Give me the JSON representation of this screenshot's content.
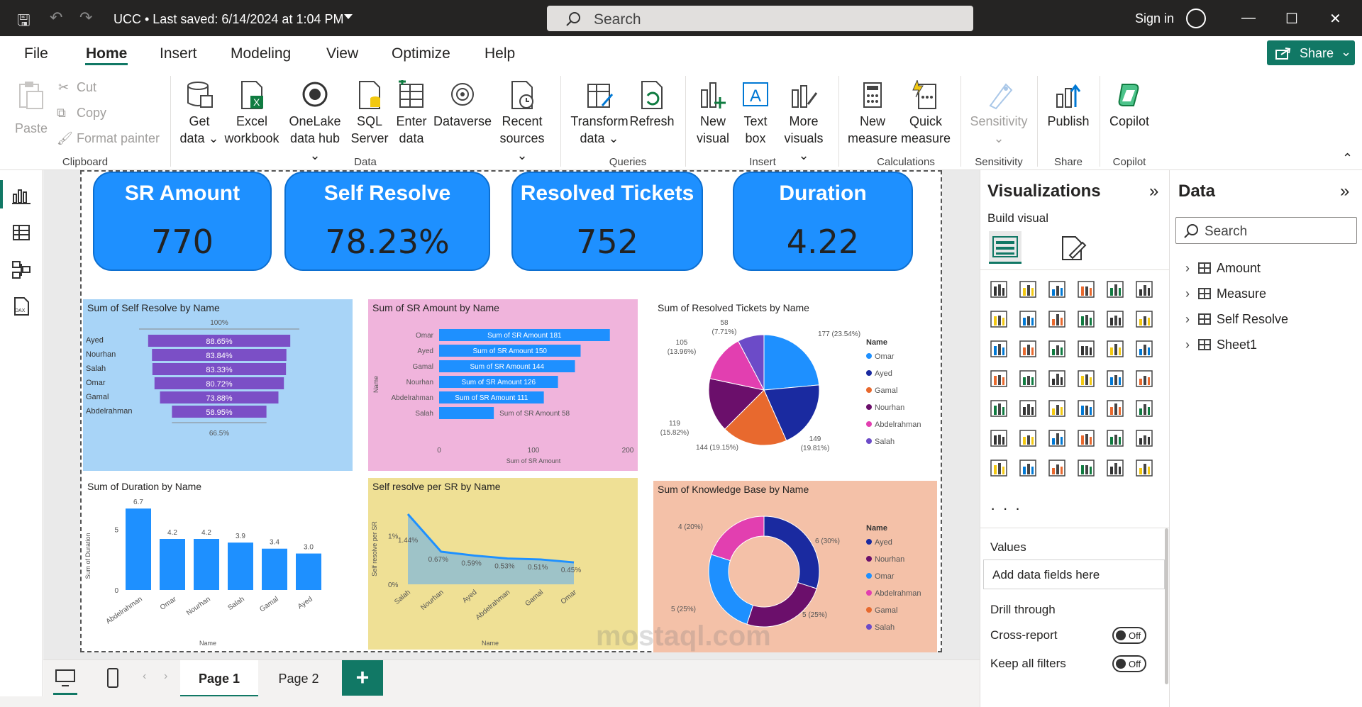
{
  "titlebar": {
    "title": "UCC • Last saved: 6/14/2024 at 1:04 PM",
    "search_placeholder": "Search",
    "sign_in": "Sign in"
  },
  "menu": {
    "tabs": [
      "File",
      "Home",
      "Insert",
      "Modeling",
      "View",
      "Optimize",
      "Help"
    ],
    "share": "Share"
  },
  "ribbon": {
    "clipboard": {
      "paste": "Paste",
      "cut": "Cut",
      "copy": "Copy",
      "format_painter": "Format painter",
      "group": "Clipboard"
    },
    "data": {
      "get_data": [
        "Get",
        "data ⌄"
      ],
      "excel": [
        "Excel",
        "workbook"
      ],
      "onelake": [
        "OneLake",
        "data hub ⌄"
      ],
      "sql": [
        "SQL",
        "Server"
      ],
      "enter": [
        "Enter",
        "data"
      ],
      "dataverse": [
        "Dataverse",
        ""
      ],
      "recent": [
        "Recent",
        "sources ⌄"
      ],
      "group": "Data"
    },
    "queries": {
      "transform": [
        "Transform",
        "data ⌄"
      ],
      "refresh": [
        "Refresh",
        ""
      ],
      "group": "Queries"
    },
    "insert": {
      "new_visual": [
        "New",
        "visual"
      ],
      "text_box": [
        "Text",
        "box"
      ],
      "more_visuals": [
        "More",
        "visuals ⌄"
      ],
      "group": "Insert"
    },
    "calculations": {
      "new_measure": [
        "New",
        "measure"
      ],
      "quick_measure": [
        "Quick",
        "measure"
      ],
      "group": "Calculations"
    },
    "sensitivity": {
      "label": [
        "Sensitivity",
        "⌄"
      ],
      "group": "Sensitivity"
    },
    "share": {
      "publish": [
        "Publish",
        ""
      ],
      "group": "Share"
    },
    "copilot": {
      "label": [
        "Copilot",
        ""
      ],
      "group": "Copilot"
    }
  },
  "kpis": [
    {
      "title": "SR Amount",
      "value": "770"
    },
    {
      "title": "Self Resolve",
      "value": "78.23%"
    },
    {
      "title": "Resolved Tickets",
      "value": "752"
    },
    {
      "title": "Duration",
      "value": "4.22"
    }
  ],
  "colors": {
    "accent": "#117865",
    "kpi": "#1e90ff",
    "funnel": "#7b4fc6",
    "bar": "#1e90ff",
    "funnel_bg": "#a8d4f7",
    "bar_bg": "#f0b4dc",
    "line_bg": "#efe095",
    "donut_bg": "#f4c1a8"
  },
  "chart_data": [
    {
      "type": "bar",
      "subtype": "funnel",
      "title": "Sum of Self Resolve by Name",
      "categories": [
        "Ayed",
        "Nourhan",
        "Salah",
        "Omar",
        "Gamal",
        "Abdelrahman"
      ],
      "values": [
        88.65,
        83.84,
        83.33,
        80.72,
        73.88,
        58.95
      ],
      "labels": [
        "88.65%",
        "83.84%",
        "83.33%",
        "80.72%",
        "73.88%",
        "58.95%"
      ],
      "top_label": "100%",
      "bottom_label": "66.5%"
    },
    {
      "type": "bar",
      "orientation": "horizontal",
      "title": "Sum of SR Amount by Name",
      "categories": [
        "Omar",
        "Ayed",
        "Gamal",
        "Nourhan",
        "Abdelrahman",
        "Salah"
      ],
      "values": [
        181,
        150,
        144,
        126,
        111,
        58
      ],
      "label_prefix": "Sum of SR Amount ",
      "xlabel": "Sum of SR Amount",
      "ylabel": "Name",
      "xlim": [
        0,
        200
      ],
      "xticks": [
        "0",
        "100",
        "200"
      ]
    },
    {
      "type": "pie",
      "title": "Sum of Resolved Tickets by Name",
      "legend_title": "Name",
      "categories": [
        "Omar",
        "Ayed",
        "Gamal",
        "Nourhan",
        "Abdelrahman",
        "Salah"
      ],
      "values": [
        177,
        149,
        144,
        119,
        105,
        58
      ],
      "labels": [
        "177 (23.54%)",
        "149 (19.81%)",
        "144 (19.15%)",
        "119 (15.82%)",
        "105 (13.96%)",
        "58 (7.71%)"
      ],
      "colors": [
        "#1e90ff",
        "#1a2aa0",
        "#e8692e",
        "#6b0f6b",
        "#e23fb0",
        "#6c4bc8"
      ]
    },
    {
      "type": "bar",
      "title": "Sum of Duration by Name",
      "categories": [
        "Abdelrahman",
        "Omar",
        "Nourhan",
        "Salah",
        "Gamal",
        "Ayed"
      ],
      "values": [
        6.7,
        4.2,
        4.2,
        3.9,
        3.4,
        3.0
      ],
      "labels": [
        "6.7",
        "4.2",
        "4.2",
        "3.9",
        "3.4",
        "3.0"
      ],
      "xlabel": "Name",
      "ylabel": "Sum of Duration",
      "ylim": [
        0,
        7
      ],
      "yticks": [
        "0",
        "5"
      ]
    },
    {
      "type": "area",
      "title": "Self resolve per SR by Name",
      "categories": [
        "Salah",
        "Nourhan",
        "Ayed",
        "Abdelrahman",
        "Gamal",
        "Omar"
      ],
      "values": [
        1.44,
        0.67,
        0.59,
        0.53,
        0.51,
        0.45
      ],
      "labels": [
        "1.44%",
        "0.67%",
        "0.59%",
        "0.53%",
        "0.51%",
        "0.45%"
      ],
      "xlabel": "Name",
      "ylabel": "Self resolve per SR",
      "ylim": [
        0,
        1.6
      ],
      "yticks": [
        "0%",
        "1%"
      ]
    },
    {
      "type": "pie",
      "subtype": "donut",
      "title": "Sum of Knowledge Base by Name",
      "legend_title": "Name",
      "categories": [
        "Ayed",
        "Nourhan",
        "Omar",
        "Abdelrahman",
        "Gamal",
        "Salah"
      ],
      "values": [
        6,
        5,
        5,
        4,
        0,
        0
      ],
      "labels": [
        "6 (30%)",
        "5 (25%)",
        "5 (25%)",
        "4 (20%)",
        "",
        ""
      ],
      "colors": [
        "#1a2aa0",
        "#6b0f6b",
        "#1e90ff",
        "#e23fb0",
        "#e8692e",
        "#6c4bc8"
      ]
    }
  ],
  "pages": {
    "tab1": "Page 1",
    "tab2": "Page 2",
    "add": "+"
  },
  "viz_pane": {
    "title": "Visualizations",
    "build": "Build visual",
    "more": "· · ·",
    "values": "Values",
    "add_fields": "Add data fields here",
    "drill": "Drill through",
    "cross_report": "Cross-report",
    "keep_filters": "Keep all filters",
    "off": "Off"
  },
  "data_pane": {
    "title": "Data",
    "search": "Search",
    "tables": [
      "Amount",
      "Measure",
      "Self Resolve",
      "Sheet1"
    ]
  },
  "watermark": "mostaql.com"
}
